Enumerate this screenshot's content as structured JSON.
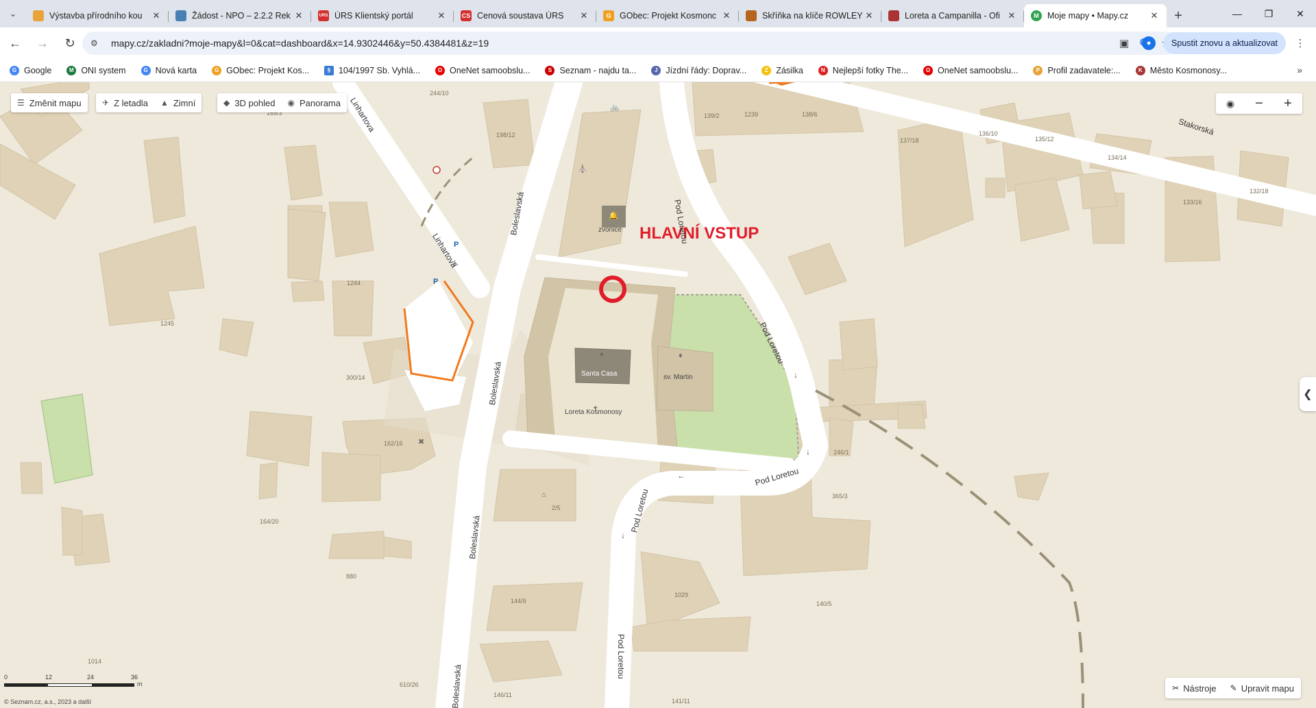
{
  "tabs": [
    {
      "title": "Výstavba přírodního kou",
      "favicon_color": "#e8a33b",
      "fav": ""
    },
    {
      "title": "Žádost - NPO – 2.2.2 Rek",
      "favicon_color": "#4a7fb5",
      "fav": ""
    },
    {
      "title": "ÚRS Klientský portál",
      "favicon_color": "#d32f2f",
      "fav": "URS"
    },
    {
      "title": "Cenová soustava ÚRS",
      "favicon_color": "#d32f2f",
      "fav": "CS"
    },
    {
      "title": "GObec: Projekt Kosmonc",
      "favicon_color": "#f0a020",
      "fav": "G"
    },
    {
      "title": "Skříňka na klíče ROWLEY",
      "favicon_color": "#b5651d",
      "fav": ""
    },
    {
      "title": "Loreta a Campanilla - Ofi",
      "favicon_color": "#a33",
      "fav": ""
    },
    {
      "title": "Moje mapy • Mapy.cz",
      "favicon_color": "#2ea44f",
      "fav": "M"
    }
  ],
  "browser": {
    "url": "mapy.cz/zakladni?moje-mapy&l=0&cat=dashboard&x=14.9302446&y=50.4384481&z=19",
    "update_label": "Spustit znovu a aktualizovat"
  },
  "bookmarks": [
    {
      "label": "Google",
      "color": "#4285f4",
      "icon": "G"
    },
    {
      "label": "ONI system",
      "color": "#1b7a3e",
      "icon": "M"
    },
    {
      "label": "Nová karta",
      "color": "#4285f4",
      "icon": "G"
    },
    {
      "label": "GObec: Projekt Kos...",
      "color": "#f0a020",
      "icon": "G"
    },
    {
      "label": "104/1997 Sb. Vyhlá...",
      "color": "#3a7bd5",
      "icon": "§"
    },
    {
      "label": "OneNet samoobslu...",
      "color": "#e60000",
      "icon": "O"
    },
    {
      "label": "Seznam - najdu ta...",
      "color": "#cc0000",
      "icon": "S"
    },
    {
      "label": "Jízdní řády: Doprav...",
      "color": "#5566aa",
      "icon": "J"
    },
    {
      "label": "Zásilka",
      "color": "#f4c20d",
      "icon": "Z"
    },
    {
      "label": "Nejlepší fotky The...",
      "color": "#d22",
      "icon": "N"
    },
    {
      "label": "OneNet samoobslu...",
      "color": "#e60000",
      "icon": "O"
    },
    {
      "label": "Profil zadavatele:...",
      "color": "#e8a33b",
      "icon": "P"
    },
    {
      "label": "Město Kosmonosy...",
      "color": "#a33",
      "icon": "K"
    }
  ],
  "map_controls": {
    "change_map": "Změnit mapu",
    "aerial": "Z letadla",
    "winter": "Zimní",
    "view3d": "3D pohled",
    "panorama": "Panorama",
    "tools": "Nástroje",
    "edit_map": "Upravit mapu"
  },
  "map_labels": {
    "annotation": "HLAVNÍ VSTUP",
    "santa_casa": "Santa Casa",
    "sv_martin": "sv. Martin",
    "loreta": "Loreta Kosmonosy",
    "zvonice": "zvonice",
    "streets": {
      "boleslavska": "Boleslavská",
      "linhartova": "Linhartova",
      "pod_loretou": "Pod Loretou",
      "stakorska": "Stakorská"
    },
    "house_numbers": [
      "244/10",
      "165/3",
      "198/12",
      "139/2",
      "1239",
      "138/6",
      "137/18",
      "136/10",
      "135/12",
      "134/14",
      "133/16",
      "132/18",
      "1244",
      "1245",
      "300/14",
      "162/16",
      "164/20",
      "880",
      "1014",
      "610/26",
      "146/11",
      "144/9",
      "1029",
      "140/5",
      "141/11",
      "246/1",
      "365/3",
      "2/5"
    ]
  },
  "scale": {
    "ticks": [
      "0",
      "12",
      "24",
      "36"
    ],
    "unit": "m"
  },
  "copyright": "© Seznam.cz, a.s., 2023 a další"
}
